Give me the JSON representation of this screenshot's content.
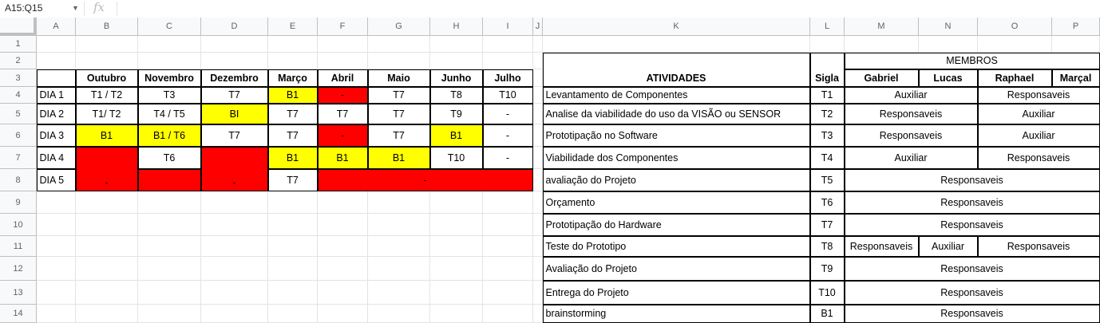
{
  "formula_bar": {
    "name_box": "A15:Q15",
    "fx_icon": "fx",
    "formula": ""
  },
  "columns": [
    "A",
    "B",
    "C",
    "D",
    "E",
    "F",
    "G",
    "H",
    "I",
    "J",
    "K",
    "L",
    "M",
    "N",
    "O",
    "P"
  ],
  "rows": [
    "1",
    "2",
    "3",
    "4",
    "5",
    "6",
    "7",
    "8",
    "9",
    "10",
    "11",
    "12",
    "13",
    "14"
  ],
  "colors": {
    "yellow": "#ffff00",
    "red": "#ff0000",
    "white": "#ffffff",
    "header_bg": "#f8f9fa"
  },
  "schedule": {
    "months": [
      "Outubro",
      "Novembro",
      "Dezembro",
      "Março",
      "Abril",
      "Maio",
      "Junho",
      "Julho"
    ],
    "days": [
      {
        "label": "DIA 1",
        "cells": [
          {
            "text": "T1 / T2",
            "status": "white"
          },
          {
            "text": "T3",
            "status": "white"
          },
          {
            "text": "T7",
            "status": "white"
          },
          {
            "text": "B1",
            "status": "yellow"
          },
          {
            "text": "-",
            "status": "red"
          },
          {
            "text": "T7",
            "status": "white"
          },
          {
            "text": "T8",
            "status": "white"
          },
          {
            "text": "T10",
            "status": "white"
          }
        ]
      },
      {
        "label": "DIA 2",
        "cells": [
          {
            "text": "T1/ T2",
            "status": "white"
          },
          {
            "text": "T4 / T5",
            "status": "white"
          },
          {
            "text": "BI",
            "status": "yellow"
          },
          {
            "text": "T7",
            "status": "white"
          },
          {
            "text": "T7",
            "status": "white"
          },
          {
            "text": "T7",
            "status": "white"
          },
          {
            "text": "T9",
            "status": "white"
          },
          {
            "text": "-",
            "status": "white"
          }
        ]
      },
      {
        "label": "DIA 3",
        "cells": [
          {
            "text": "B1",
            "status": "yellow"
          },
          {
            "text": "B1 / T6",
            "status": "yellow"
          },
          {
            "text": "T7",
            "status": "white"
          },
          {
            "text": "T7",
            "status": "white"
          },
          {
            "text": "-",
            "status": "red"
          },
          {
            "text": "T7",
            "status": "white"
          },
          {
            "text": "B1",
            "status": "yellow"
          },
          {
            "text": "-",
            "status": "white"
          }
        ]
      },
      {
        "label": "DIA 4",
        "cells": [
          {
            "text": "-",
            "status": "red",
            "note": "merged with DIA 5"
          },
          {
            "text": "T6",
            "status": "white"
          },
          {
            "text": "-",
            "status": "red",
            "note": "merged with DIA 5"
          },
          {
            "text": "B1",
            "status": "yellow"
          },
          {
            "text": "B1",
            "status": "yellow"
          },
          {
            "text": "B1",
            "status": "yellow"
          },
          {
            "text": "T10",
            "status": "white"
          },
          {
            "text": "-",
            "status": "white"
          }
        ]
      },
      {
        "label": "DIA 5",
        "cells": [
          {
            "text": "",
            "status": "red"
          },
          {
            "text": "T7",
            "status": "white"
          },
          {
            "text": "-",
            "status": "red"
          }
        ]
      }
    ]
  },
  "activities": {
    "header": {
      "atividades": "ATIVIDADES",
      "sigla": "Sigla",
      "membros": "MEMBROS",
      "members": [
        "Gabriel",
        "Lucas",
        "Raphael",
        "Marçal"
      ]
    },
    "items": [
      {
        "name": "Levantamento de Componentes",
        "sigla": "T1",
        "roles": [
          "Auxiliar",
          "Responsaveis"
        ]
      },
      {
        "name": "Analise da viabilidade do uso da VISÃO ou SENSOR",
        "sigla": "T2",
        "roles": [
          "Responsaveis",
          "Auxiliar"
        ]
      },
      {
        "name": "Prototipação no Software",
        "sigla": "T3",
        "roles": [
          "Responsaveis",
          "Auxiliar"
        ]
      },
      {
        "name": "Viabilidade dos Componentes",
        "sigla": "T4",
        "roles": [
          "Auxiliar",
          "Responsaveis"
        ]
      },
      {
        "name": "avaliação do Projeto",
        "sigla": "T5",
        "roles": [
          "Responsaveis"
        ]
      },
      {
        "name": "Orçamento",
        "sigla": "T6",
        "roles": [
          "Responsaveis"
        ]
      },
      {
        "name": "Prototipação do Hardware",
        "sigla": "T7",
        "roles": [
          "Responsaveis"
        ]
      },
      {
        "name": "Teste do Prototipo",
        "sigla": "T8",
        "roles": [
          "Responsaveis",
          "Auxiliar",
          "Responsaveis"
        ]
      },
      {
        "name": "Avaliação do Projeto",
        "sigla": "T9",
        "roles": [
          "Responsaveis"
        ]
      },
      {
        "name": "Entrega do Projeto",
        "sigla": "T10",
        "roles": [
          "Responsaveis"
        ]
      },
      {
        "name": "brainstorming",
        "sigla": "B1",
        "roles": [
          "Responsaveis"
        ]
      }
    ]
  }
}
